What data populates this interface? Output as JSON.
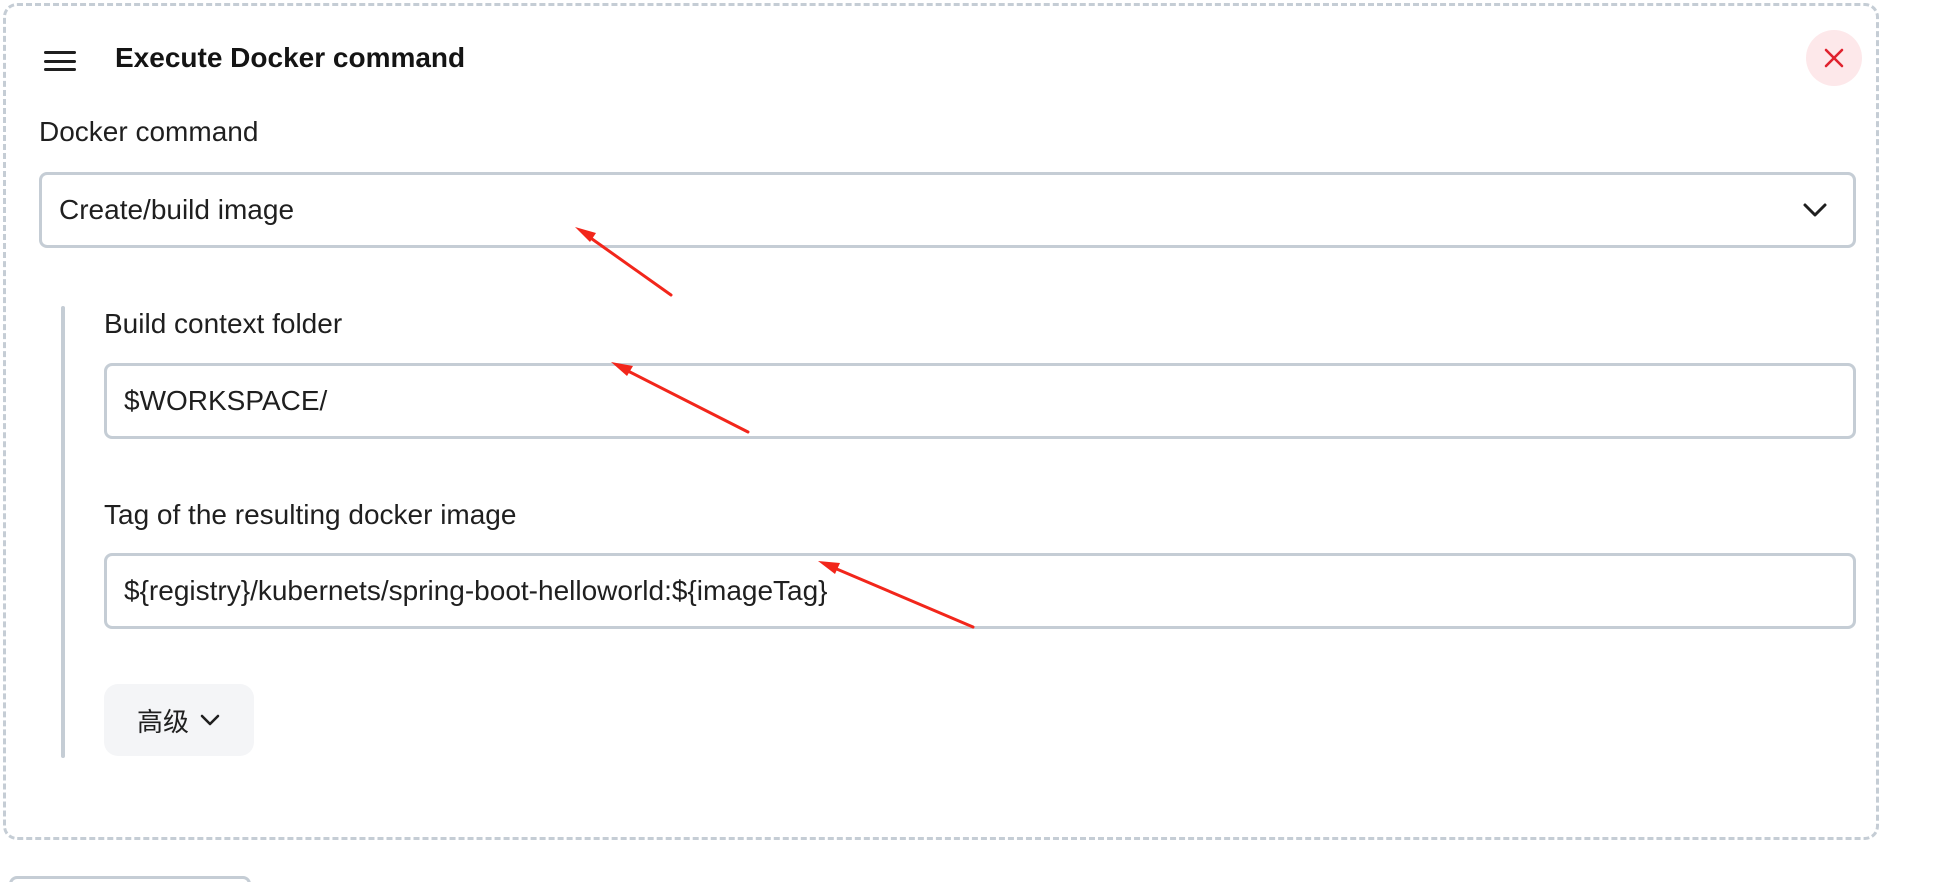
{
  "step": {
    "title": "Execute Docker command",
    "drag_icon": "hamburger-menu-icon",
    "close_icon": "close-x-icon",
    "close_color": "#e0222e"
  },
  "docker_command": {
    "label": "Docker command",
    "selected": "Create/build image",
    "chevron_icon": "chevron-down-icon"
  },
  "build_context": {
    "label": "Build context folder",
    "value": "$WORKSPACE/"
  },
  "image_tag": {
    "label": "Tag of the resulting docker image",
    "value": "${registry}/kubernets/spring-boot-helloworld:${imageTag}"
  },
  "advanced": {
    "label": "高级",
    "chevron_icon": "chevron-down-icon"
  },
  "annotations": {
    "color": "#f2261b",
    "icon": "red-arrow-icon"
  }
}
